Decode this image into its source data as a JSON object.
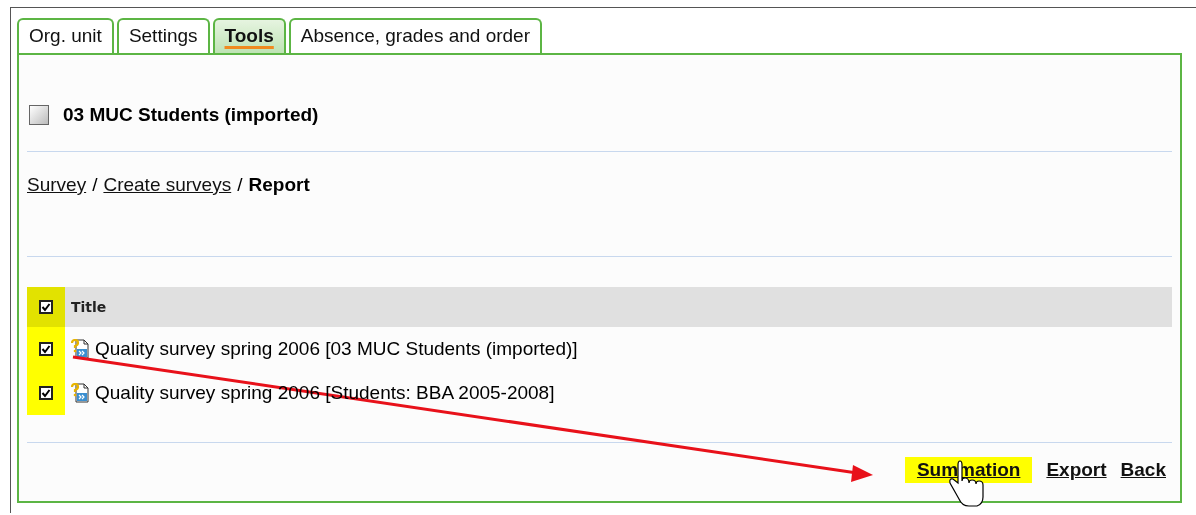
{
  "tabs": [
    {
      "label": "Org. unit",
      "selected": false
    },
    {
      "label": "Settings",
      "selected": false
    },
    {
      "label": "Tools",
      "selected": true
    },
    {
      "label": "Absence, grades and order",
      "selected": false
    }
  ],
  "heading": {
    "title": "03 MUC Students (imported)"
  },
  "breadcrumb": [
    {
      "label": "Survey",
      "kind": "link"
    },
    {
      "label": "/",
      "kind": "separator"
    },
    {
      "label": "Create surveys",
      "kind": "link"
    },
    {
      "label": "/",
      "kind": "separator"
    },
    {
      "label": "Report",
      "kind": "current"
    }
  ],
  "table": {
    "check_column_highlighted": true,
    "header_checked": true,
    "columns": [
      "Title"
    ],
    "rows": [
      {
        "title": "Quality survey spring 2006 [03 MUC Students (imported)]",
        "checked": true
      },
      {
        "title": "Quality survey spring 2006 [Students: BBA 2005-2008]",
        "checked": true
      }
    ]
  },
  "actions": [
    {
      "label": "Summation",
      "highlighted": true
    },
    {
      "label": "Export",
      "highlighted": false
    },
    {
      "label": "Back",
      "highlighted": false
    }
  ]
}
